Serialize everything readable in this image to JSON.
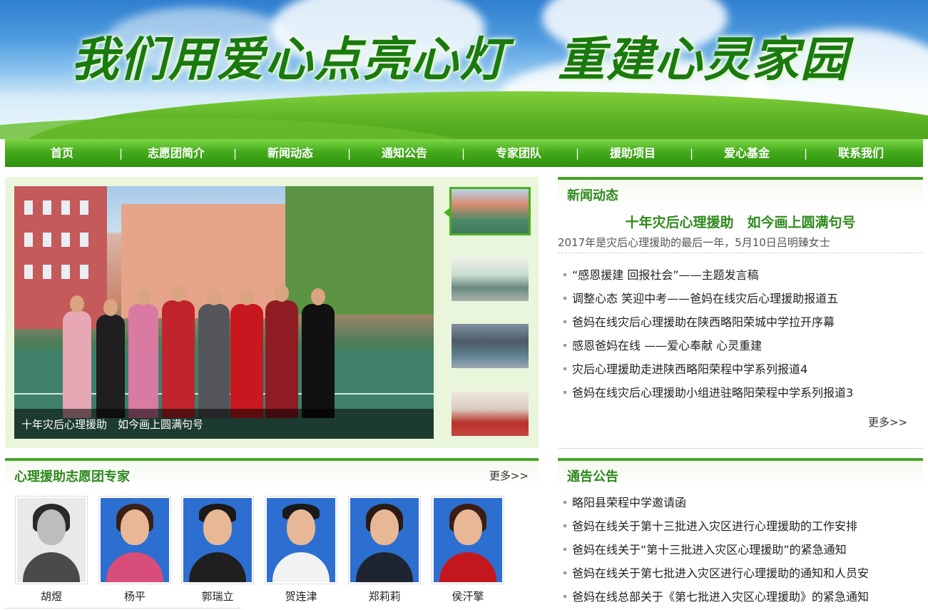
{
  "banner": {
    "slogan_part1": "我们用爱心点亮心灯",
    "slogan_part2": "重建心灵家园"
  },
  "nav": {
    "items": [
      "首页",
      "志愿团简介",
      "新闻动态",
      "通知公告",
      "专家团队",
      "援助项目",
      "爱心基金",
      "联系我们"
    ],
    "separator": "|"
  },
  "slideshow": {
    "caption": "十年灾后心理援助　如今画上圆满句号",
    "thumbnails": [
      "thumb-1",
      "thumb-2",
      "thumb-3",
      "thumb-4"
    ],
    "active_index": 0
  },
  "news": {
    "title": "新闻动态",
    "feature_title": "十年灾后心理援助　如今画上圆满句号",
    "feature_desc": "2017年是灾后心理援助的最后一年，5月10日吕明臻女士",
    "items": [
      "“感恩援建 回报社会”——主题发言稿",
      "调整心态 笑迎中考——爸妈在线灾后心理援助报道五",
      "爸妈在线灾后心理援助在陕西略阳荣城中学拉开序幕",
      "感恩爸妈在线 ——爱心奉献 心灵重建",
      "灾后心理援助走进陕西略阳荣程中学系列报道4",
      "爸妈在线灾后心理援助小组进驻略阳荣程中学系列报道3"
    ],
    "more": "更多>>"
  },
  "experts": {
    "title": "心理援助志愿团专家",
    "more": "更多>>",
    "people": [
      {
        "name": "胡煜"
      },
      {
        "name": "杨平"
      },
      {
        "name": "郭瑞立"
      },
      {
        "name": "贺连津"
      },
      {
        "name": "郑莉莉"
      },
      {
        "name": "侯汗擎"
      }
    ]
  },
  "notices": {
    "title": "通告公告",
    "items": [
      "略阳县荣程中学邀请函",
      "爸妈在线关于第十三批进入灾区进行心理援助的工作安排",
      "爸妈在线关于“第十三批进入灾区心理援助”的紧急通知",
      "爸妈在线关于第七批进入灾区进行心理援助的通知和人员安",
      "爸妈在线总部关于《第七批进入灾区心理援助》的紧急通知"
    ]
  },
  "colors": {
    "brand_green": "#2e8a1d",
    "nav_green": "#45ac1d",
    "panel_bg": "#eaf6dc"
  }
}
